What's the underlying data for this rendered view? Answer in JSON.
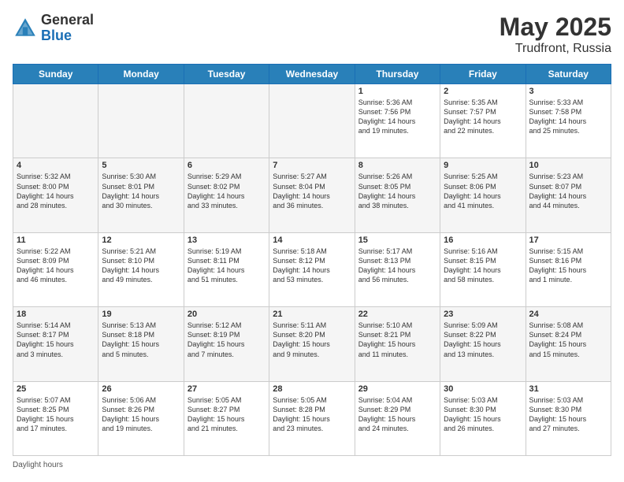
{
  "header": {
    "logo_general": "General",
    "logo_blue": "Blue",
    "title": "May 2025",
    "location": "Trudfront, Russia"
  },
  "footer": {
    "daylight_label": "Daylight hours"
  },
  "days_of_week": [
    "Sunday",
    "Monday",
    "Tuesday",
    "Wednesday",
    "Thursday",
    "Friday",
    "Saturday"
  ],
  "weeks": [
    [
      {
        "num": "",
        "info": ""
      },
      {
        "num": "",
        "info": ""
      },
      {
        "num": "",
        "info": ""
      },
      {
        "num": "",
        "info": ""
      },
      {
        "num": "1",
        "info": "Sunrise: 5:36 AM\nSunset: 7:56 PM\nDaylight: 14 hours\nand 19 minutes."
      },
      {
        "num": "2",
        "info": "Sunrise: 5:35 AM\nSunset: 7:57 PM\nDaylight: 14 hours\nand 22 minutes."
      },
      {
        "num": "3",
        "info": "Sunrise: 5:33 AM\nSunset: 7:58 PM\nDaylight: 14 hours\nand 25 minutes."
      }
    ],
    [
      {
        "num": "4",
        "info": "Sunrise: 5:32 AM\nSunset: 8:00 PM\nDaylight: 14 hours\nand 28 minutes."
      },
      {
        "num": "5",
        "info": "Sunrise: 5:30 AM\nSunset: 8:01 PM\nDaylight: 14 hours\nand 30 minutes."
      },
      {
        "num": "6",
        "info": "Sunrise: 5:29 AM\nSunset: 8:02 PM\nDaylight: 14 hours\nand 33 minutes."
      },
      {
        "num": "7",
        "info": "Sunrise: 5:27 AM\nSunset: 8:04 PM\nDaylight: 14 hours\nand 36 minutes."
      },
      {
        "num": "8",
        "info": "Sunrise: 5:26 AM\nSunset: 8:05 PM\nDaylight: 14 hours\nand 38 minutes."
      },
      {
        "num": "9",
        "info": "Sunrise: 5:25 AM\nSunset: 8:06 PM\nDaylight: 14 hours\nand 41 minutes."
      },
      {
        "num": "10",
        "info": "Sunrise: 5:23 AM\nSunset: 8:07 PM\nDaylight: 14 hours\nand 44 minutes."
      }
    ],
    [
      {
        "num": "11",
        "info": "Sunrise: 5:22 AM\nSunset: 8:09 PM\nDaylight: 14 hours\nand 46 minutes."
      },
      {
        "num": "12",
        "info": "Sunrise: 5:21 AM\nSunset: 8:10 PM\nDaylight: 14 hours\nand 49 minutes."
      },
      {
        "num": "13",
        "info": "Sunrise: 5:19 AM\nSunset: 8:11 PM\nDaylight: 14 hours\nand 51 minutes."
      },
      {
        "num": "14",
        "info": "Sunrise: 5:18 AM\nSunset: 8:12 PM\nDaylight: 14 hours\nand 53 minutes."
      },
      {
        "num": "15",
        "info": "Sunrise: 5:17 AM\nSunset: 8:13 PM\nDaylight: 14 hours\nand 56 minutes."
      },
      {
        "num": "16",
        "info": "Sunrise: 5:16 AM\nSunset: 8:15 PM\nDaylight: 14 hours\nand 58 minutes."
      },
      {
        "num": "17",
        "info": "Sunrise: 5:15 AM\nSunset: 8:16 PM\nDaylight: 15 hours\nand 1 minute."
      }
    ],
    [
      {
        "num": "18",
        "info": "Sunrise: 5:14 AM\nSunset: 8:17 PM\nDaylight: 15 hours\nand 3 minutes."
      },
      {
        "num": "19",
        "info": "Sunrise: 5:13 AM\nSunset: 8:18 PM\nDaylight: 15 hours\nand 5 minutes."
      },
      {
        "num": "20",
        "info": "Sunrise: 5:12 AM\nSunset: 8:19 PM\nDaylight: 15 hours\nand 7 minutes."
      },
      {
        "num": "21",
        "info": "Sunrise: 5:11 AM\nSunset: 8:20 PM\nDaylight: 15 hours\nand 9 minutes."
      },
      {
        "num": "22",
        "info": "Sunrise: 5:10 AM\nSunset: 8:21 PM\nDaylight: 15 hours\nand 11 minutes."
      },
      {
        "num": "23",
        "info": "Sunrise: 5:09 AM\nSunset: 8:22 PM\nDaylight: 15 hours\nand 13 minutes."
      },
      {
        "num": "24",
        "info": "Sunrise: 5:08 AM\nSunset: 8:24 PM\nDaylight: 15 hours\nand 15 minutes."
      }
    ],
    [
      {
        "num": "25",
        "info": "Sunrise: 5:07 AM\nSunset: 8:25 PM\nDaylight: 15 hours\nand 17 minutes."
      },
      {
        "num": "26",
        "info": "Sunrise: 5:06 AM\nSunset: 8:26 PM\nDaylight: 15 hours\nand 19 minutes."
      },
      {
        "num": "27",
        "info": "Sunrise: 5:05 AM\nSunset: 8:27 PM\nDaylight: 15 hours\nand 21 minutes."
      },
      {
        "num": "28",
        "info": "Sunrise: 5:05 AM\nSunset: 8:28 PM\nDaylight: 15 hours\nand 23 minutes."
      },
      {
        "num": "29",
        "info": "Sunrise: 5:04 AM\nSunset: 8:29 PM\nDaylight: 15 hours\nand 24 minutes."
      },
      {
        "num": "30",
        "info": "Sunrise: 5:03 AM\nSunset: 8:30 PM\nDaylight: 15 hours\nand 26 minutes."
      },
      {
        "num": "31",
        "info": "Sunrise: 5:03 AM\nSunset: 8:30 PM\nDaylight: 15 hours\nand 27 minutes."
      }
    ]
  ]
}
